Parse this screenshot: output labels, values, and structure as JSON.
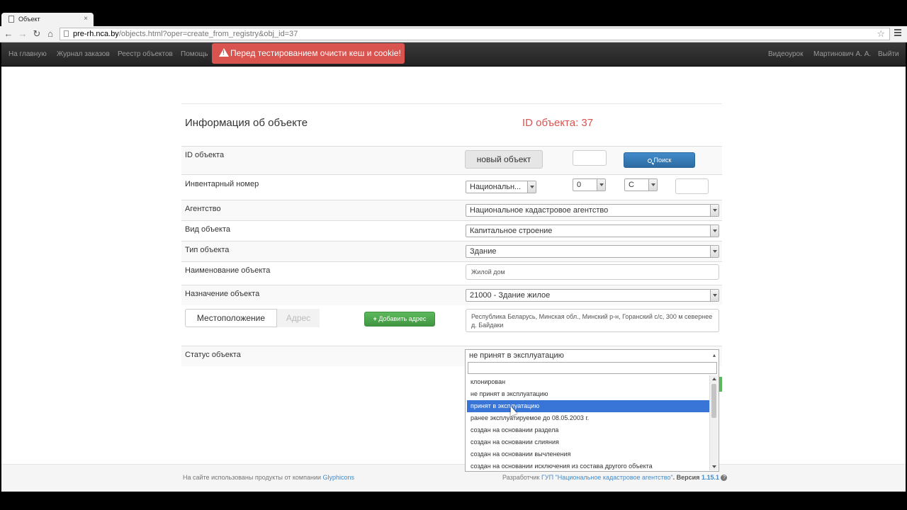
{
  "browser": {
    "tab_title": "Объект",
    "tab_close": "×",
    "url_host": "pre-rh.nca.by",
    "url_path": "/objects.html?oper=create_from_registry&obj_id=37",
    "back": "←",
    "forward": "→",
    "reload": "↻",
    "home": "⌂",
    "star": "☆"
  },
  "navbar": {
    "items": [
      "На главную",
      "Журнал заказов",
      "Реестр объектов",
      "Помощь"
    ],
    "alert": "Перед тестированием очисти кеш и cookie!",
    "right_items": [
      "Видеоурок",
      "Мартинович А. А.",
      "Выйти"
    ]
  },
  "panel": {
    "title": "Информация об объекте",
    "object_id": "ID объекта: 37"
  },
  "form": {
    "id_label": "ID объекта",
    "new_object_button": "новый объект",
    "id_input_value": "",
    "search_button": "Поиск",
    "inventory_label": "Инвентарный номер",
    "inventory_select_1": "Национальн...",
    "inventory_select_2": "0",
    "inventory_select_3": "С",
    "inventory_input_value": "",
    "agency_label": "Агентство",
    "agency_value": "Национальное кадастровое агентство",
    "kind_label": "Вид объекта",
    "kind_value": "Капитальное строение",
    "type_label": "Тип объекта",
    "type_value": "Здание",
    "name_label": "Наименование объекта",
    "name_value": "Жилой дом",
    "purpose_label": "Назначение объекта",
    "purpose_value": "21000 - Здание жилое",
    "tab_location": "Местоположение",
    "tab_address": "Адрес",
    "add_address_button": "Добавить адрес",
    "address_text": "Республика Беларусь, Минская обл., Минский р-н, Горанский с/с, 300 м севернее д. Байдаки",
    "status_label": "Статус объекта",
    "status_value": "не принят в эксплуатацию",
    "status_search_value": "",
    "status_options": [
      "клонирован",
      "не принят в эксплуатацию",
      "принят в эксплуатацию",
      "ранее эксплуатируемое до 08.05.2003 г.",
      "создан на основании раздела",
      "создан на основании слияния",
      "создан на основании вычленения",
      "создан на основании исключения из состава другого объекта"
    ],
    "highlighted_option_index": 2
  },
  "footer": {
    "left_text": "На сайте использованы продукты от компании ",
    "left_link": "Glyphicons",
    "dev_label": "Разработчик ",
    "dev_link": "ГУП \"Национальное кадастровое агентство\"",
    "version_label": ". Версия ",
    "version": "1.15.1",
    "help_icon": "?"
  }
}
